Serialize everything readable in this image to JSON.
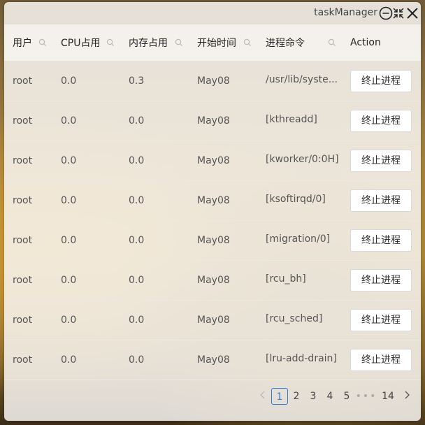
{
  "window": {
    "title": "taskManager"
  },
  "columns": [
    {
      "label": "用户",
      "searchable": true
    },
    {
      "label": "CPU占用",
      "searchable": true
    },
    {
      "label": "内存占用",
      "searchable": true
    },
    {
      "label": "开始时间",
      "searchable": true
    },
    {
      "label": "进程命令",
      "searchable": true
    },
    {
      "label": "Action",
      "searchable": false
    }
  ],
  "rows": [
    {
      "user": "root",
      "cpu": "0.0",
      "mem": "0.3",
      "start": "May08",
      "cmd": "/usr/lib/syste...",
      "action": "终止进程"
    },
    {
      "user": "root",
      "cpu": "0.0",
      "mem": "0.0",
      "start": "May08",
      "cmd": "[kthreadd]",
      "action": "终止进程"
    },
    {
      "user": "root",
      "cpu": "0.0",
      "mem": "0.0",
      "start": "May08",
      "cmd": "[kworker/0:0H]",
      "action": "终止进程"
    },
    {
      "user": "root",
      "cpu": "0.0",
      "mem": "0.0",
      "start": "May08",
      "cmd": "[ksoftirqd/0]",
      "action": "终止进程"
    },
    {
      "user": "root",
      "cpu": "0.0",
      "mem": "0.0",
      "start": "May08",
      "cmd": "[migration/0]",
      "action": "终止进程"
    },
    {
      "user": "root",
      "cpu": "0.0",
      "mem": "0.0",
      "start": "May08",
      "cmd": "[rcu_bh]",
      "action": "终止进程"
    },
    {
      "user": "root",
      "cpu": "0.0",
      "mem": "0.0",
      "start": "May08",
      "cmd": "[rcu_sched]",
      "action": "终止进程"
    },
    {
      "user": "root",
      "cpu": "0.0",
      "mem": "0.0",
      "start": "May08",
      "cmd": "[lru-add-drain]",
      "action": "终止进程"
    }
  ],
  "pagination": {
    "pages": [
      "1",
      "2",
      "3",
      "4",
      "5"
    ],
    "current": "1",
    "ellipsis": "•••",
    "last": "14"
  },
  "icons": {
    "minimize": "minimize-icon",
    "restore": "restore-icon",
    "close": "close-icon",
    "search": "search-icon",
    "prev": "chevron-left-icon",
    "next": "chevron-right-icon"
  }
}
